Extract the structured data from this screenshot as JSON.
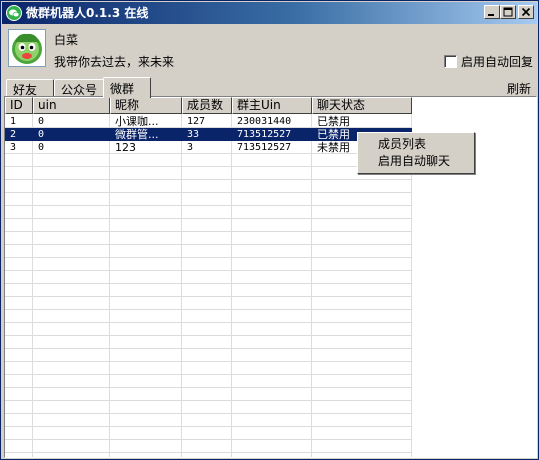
{
  "window": {
    "title": "微群机器人0.1.3  在线"
  },
  "profile": {
    "nickname": "白菜",
    "signature": "我带你去过去，来未来"
  },
  "auto_reply": {
    "label": "启用自动回复",
    "checked": false
  },
  "tabs": [
    {
      "label": "好友"
    },
    {
      "label": "公众号"
    },
    {
      "label": "微群",
      "active": true
    }
  ],
  "refresh_label": "刷新",
  "table": {
    "columns": [
      "ID",
      "uin",
      "昵称",
      "成员数",
      "群主Uin",
      "聊天状态"
    ],
    "rows": [
      [
        "1",
        "0",
        "小课咖...",
        "127",
        "230031440",
        "已禁用"
      ],
      [
        "2",
        "0",
        "微群管...",
        "33",
        "713512527",
        "已禁用"
      ],
      [
        "3",
        "0",
        "123",
        "3",
        "713512527",
        "未禁用"
      ]
    ],
    "selected_row": 2
  },
  "context_menu": {
    "items": [
      {
        "label": "成员列表"
      },
      {
        "label": "启用自动聊天"
      }
    ]
  },
  "colors": {
    "selection": "#0a246a",
    "title_gradient_start": "#0a246a",
    "title_gradient_end": "#a6caf0",
    "face": "#d4d0c8"
  },
  "icons": {
    "title": "wechat-icon",
    "avatar": "green-cartoon-avatar"
  }
}
